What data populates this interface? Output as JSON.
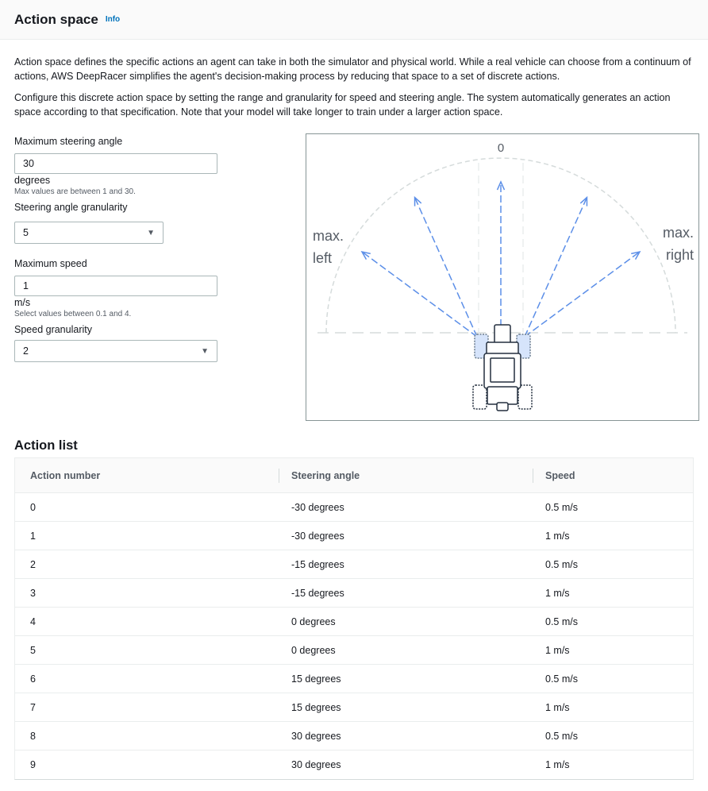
{
  "header": {
    "title": "Action space",
    "info_link": "Info"
  },
  "description": {
    "p1": "Action space defines the specific actions an agent can take in both the simulator and physical world. While a real vehicle can choose from a continuum of actions, AWS DeepRacer simplifies the agent's decision-making process by reducing that space to a set of discrete actions.",
    "p2": "Configure this discrete action space by setting the range and granularity for speed and steering angle. The system automatically generates an action space according to that specification. Note that your model will take longer to train under a larger action space."
  },
  "form": {
    "max_steering": {
      "label": "Maximum steering angle",
      "value": "30",
      "unit": "degrees",
      "hint": "Max values are between 1 and 30."
    },
    "steering_granularity": {
      "label": "Steering angle granularity",
      "value": "5"
    },
    "max_speed": {
      "label": "Maximum speed",
      "value": "1",
      "unit": "m/s",
      "hint": "Select values between 0.1 and 4."
    },
    "speed_granularity": {
      "label": "Speed granularity",
      "value": "2"
    }
  },
  "diagram": {
    "center_label": "0",
    "left_label_1": "max.",
    "left_label_2": "left",
    "right_label_1": "max.",
    "right_label_2": "right",
    "steering_angles": [
      -30,
      -15,
      0,
      15,
      30
    ],
    "arrow_color": "#5c8fe8",
    "arc_color": "#d5dbdb"
  },
  "action_list": {
    "title": "Action list",
    "columns": [
      "Action number",
      "Steering angle",
      "Speed"
    ],
    "rows": [
      [
        "0",
        "-30 degrees",
        "0.5 m/s"
      ],
      [
        "1",
        "-30 degrees",
        "1 m/s"
      ],
      [
        "2",
        "-15 degrees",
        "0.5 m/s"
      ],
      [
        "3",
        "-15 degrees",
        "1 m/s"
      ],
      [
        "4",
        "0 degrees",
        "0.5 m/s"
      ],
      [
        "5",
        "0 degrees",
        "1 m/s"
      ],
      [
        "6",
        "15 degrees",
        "0.5 m/s"
      ],
      [
        "7",
        "15 degrees",
        "1 m/s"
      ],
      [
        "8",
        "30 degrees",
        "0.5 m/s"
      ],
      [
        "9",
        "30 degrees",
        "1 m/s"
      ]
    ]
  }
}
